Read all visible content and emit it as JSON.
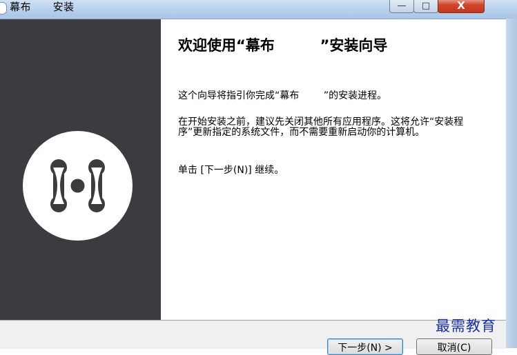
{
  "window": {
    "title": "幕布      安装",
    "minimize_glyph": "—",
    "maximize_glyph": "□",
    "close_glyph": "X"
  },
  "content": {
    "heading": "欢迎使用“幕布         ”安装向导",
    "paragraph1": "这个向导将指引你完成“幕布        ”的安装进程。",
    "paragraph2": "在开始安装之前，建议先关闭其他所有应用程序。这将允许“安装程序”更新指定的系统文件，而不需要重新启动你的计算机。",
    "paragraph3": "单击 [下一步(N)] 继续。"
  },
  "buttons": {
    "next": "下一步(N) >",
    "cancel": "取消(C)"
  },
  "watermark": "最需教育",
  "colors": {
    "sidebar": "#3b3c40",
    "logo_bg": "#ffffff",
    "logo_mark": "#3b3c40",
    "close_button": "#c4361d"
  },
  "icons": {
    "logo": "mubu-logo-icon"
  }
}
